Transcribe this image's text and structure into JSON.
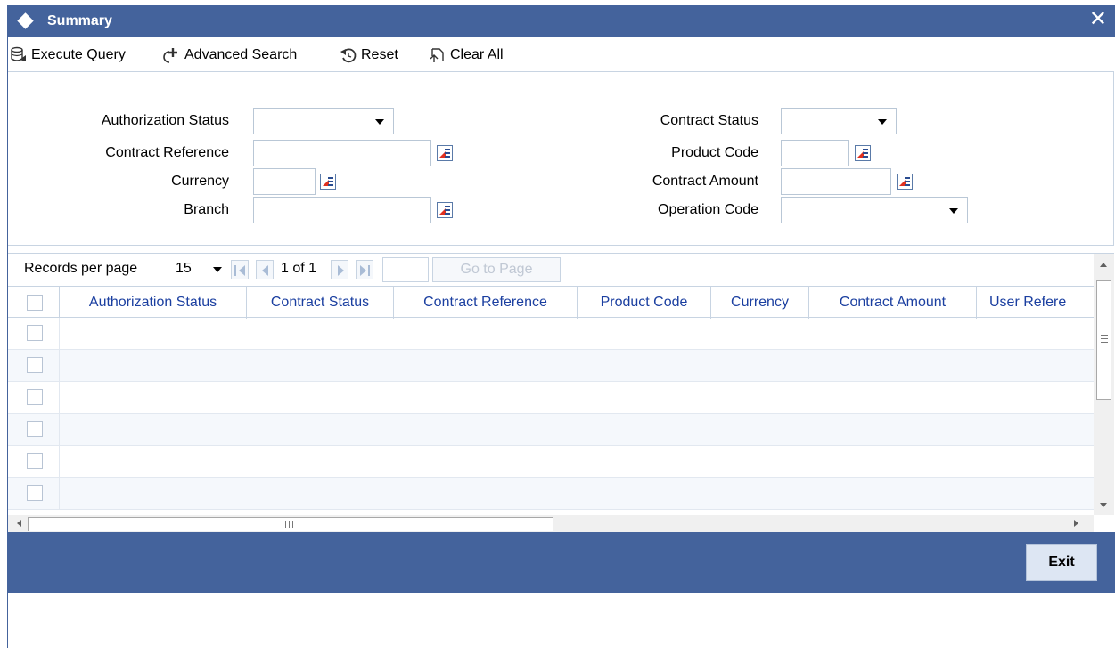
{
  "window": {
    "title": "Summary",
    "close_symbol": "✕"
  },
  "toolbar": {
    "execute_query": "Execute Query",
    "advanced_search": "Advanced Search",
    "reset": "Reset",
    "clear_all": "Clear All"
  },
  "search": {
    "authorization_status": {
      "label": "Authorization Status",
      "value": ""
    },
    "contract_reference": {
      "label": "Contract Reference",
      "value": ""
    },
    "currency": {
      "label": "Currency",
      "value": ""
    },
    "branch": {
      "label": "Branch",
      "value": ""
    },
    "contract_status": {
      "label": "Contract Status",
      "value": ""
    },
    "product_code": {
      "label": "Product Code",
      "value": ""
    },
    "contract_amount": {
      "label": "Contract Amount",
      "value": ""
    },
    "operation_code": {
      "label": "Operation Code",
      "value": ""
    }
  },
  "pager": {
    "records_per_page_label": "Records per page",
    "records_per_page_value": "15",
    "page_info": "1 of 1",
    "page_input": "",
    "goto_label": "Go to Page"
  },
  "grid": {
    "columns": [
      "Authorization Status",
      "Contract Status",
      "Contract Reference",
      "Product Code",
      "Currency",
      "Contract Amount",
      "User Refere"
    ],
    "row_count": 6
  },
  "footer": {
    "exit_label": "Exit"
  },
  "colors": {
    "header_bg": "#44639c",
    "column_header_text": "#1b3fa0",
    "lov_red": "#e03020"
  },
  "icons": {
    "title": "diamond-icon",
    "execute_query": "database-query-icon",
    "advanced_search": "advanced-search-icon",
    "reset": "reset-icon",
    "clear_all": "clear-all-icon",
    "lov": "list-of-values-icon"
  }
}
